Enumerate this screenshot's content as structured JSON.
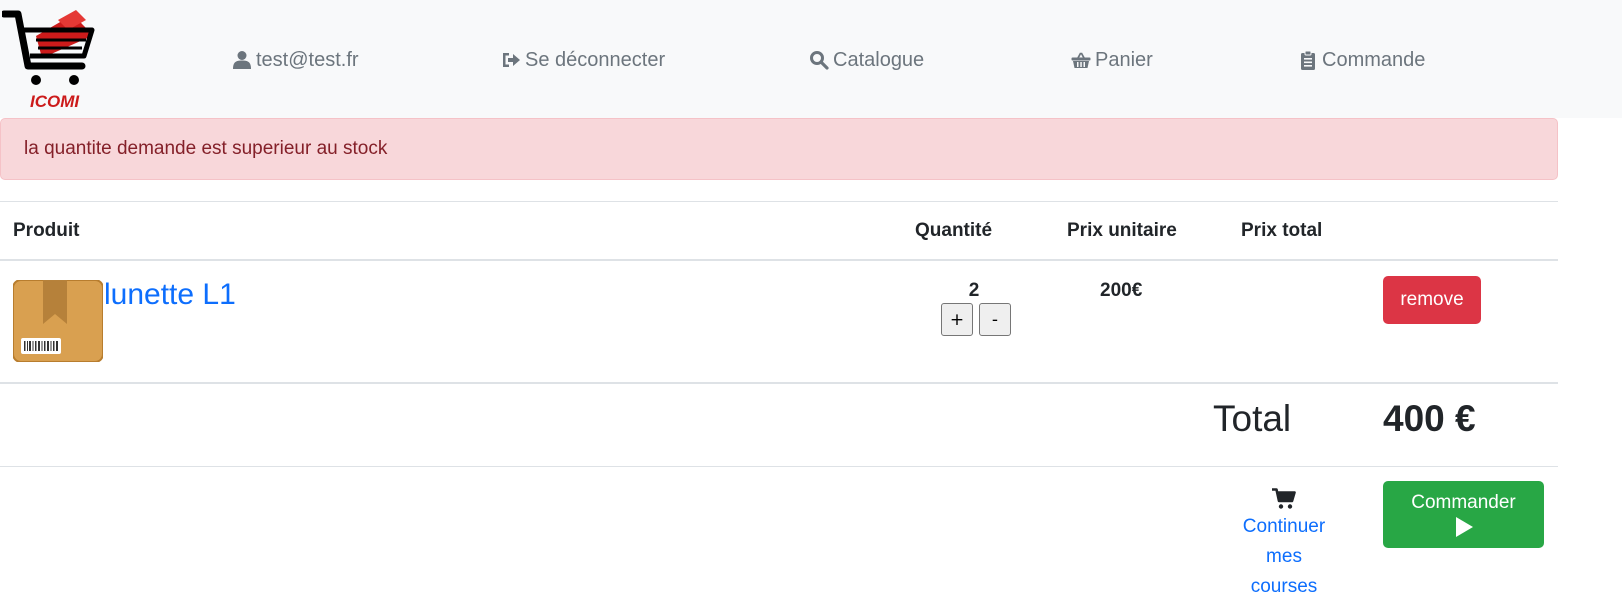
{
  "brand": {
    "logo_text": "ICOMI"
  },
  "nav": {
    "user": {
      "label": "test@test.fr",
      "icon": "user-icon"
    },
    "logout": {
      "label": "Se déconnecter",
      "icon": "sign-out-icon"
    },
    "catalogue": {
      "label": "Catalogue",
      "icon": "search-icon"
    },
    "panier": {
      "label": "Panier",
      "icon": "basket-icon"
    },
    "commande": {
      "label": "Commande",
      "icon": "clipboard-icon"
    }
  },
  "alert": {
    "message": "la quantite demande est superieur au stock"
  },
  "table": {
    "headers": {
      "produit": "Produit",
      "quantite": "Quantité",
      "prix_unitaire": "Prix unitaire",
      "prix_total": "Prix total"
    },
    "rows": [
      {
        "name": "lunette L1",
        "quantity": "2",
        "unit_price": "200€",
        "plus_label": "+",
        "minus_label": "-",
        "remove_label": "remove"
      }
    ]
  },
  "summary": {
    "total_label": "Total",
    "total_value": "400 €"
  },
  "actions": {
    "continue_label": "Continuer mes courses",
    "commander_label": "Commander"
  },
  "colors": {
    "alert_bg": "#f8d7da",
    "alert_text": "#842029",
    "danger": "#dc3545",
    "success": "#28a745",
    "link": "#0d6efd"
  }
}
